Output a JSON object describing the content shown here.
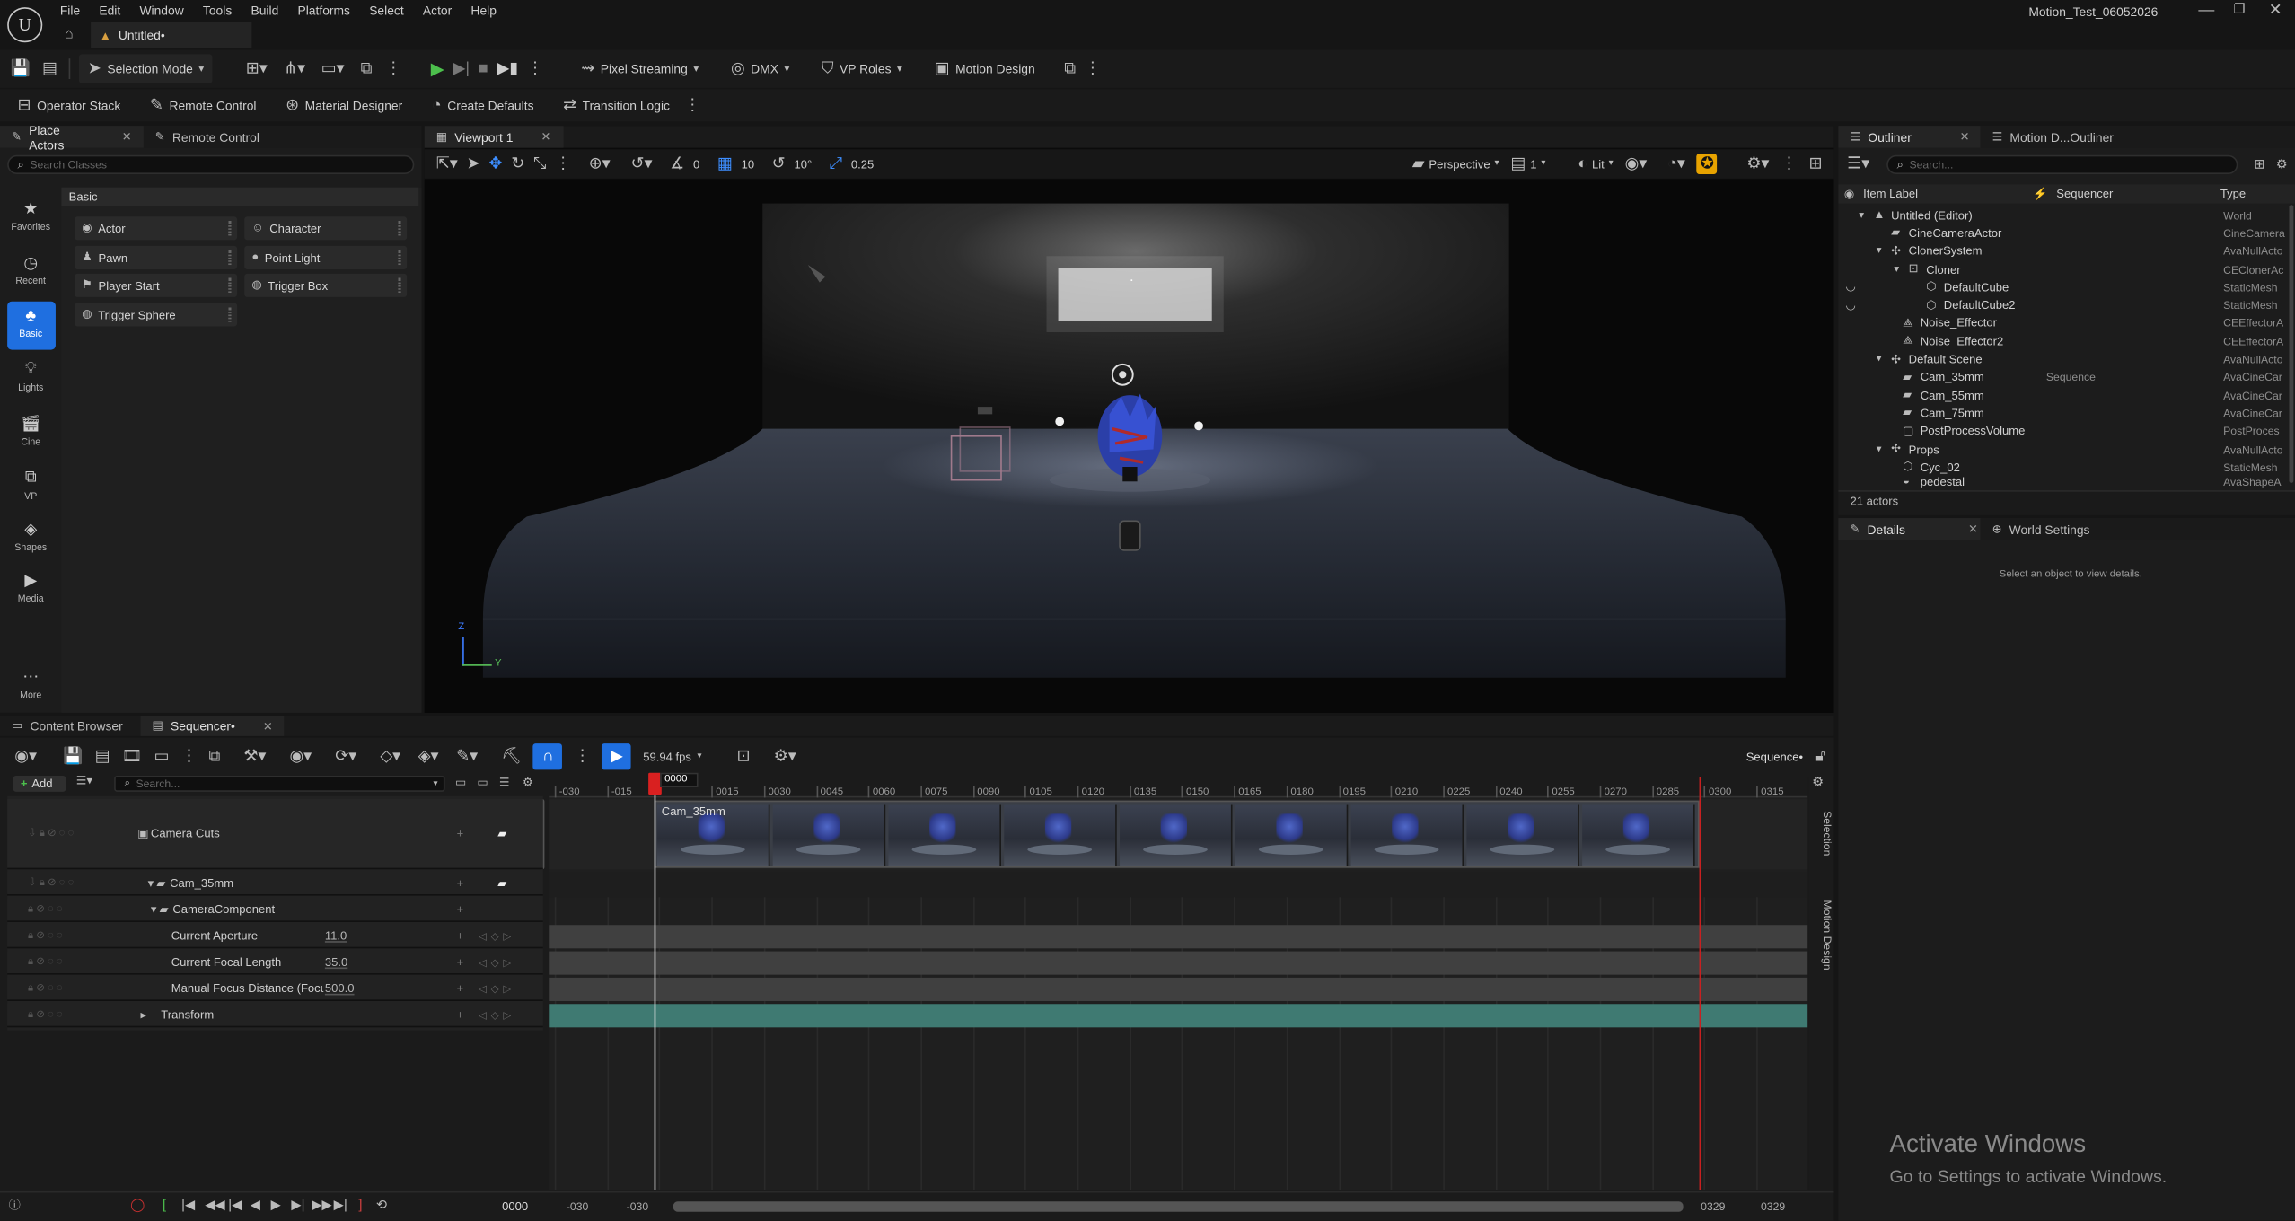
{
  "titlebar": {
    "menu": [
      "File",
      "Edit",
      "Window",
      "Tools",
      "Build",
      "Platforms",
      "Select",
      "Actor",
      "Help"
    ],
    "doc_tab": "Untitled•",
    "project_name": "Motion_Test_06052026",
    "window_controls": [
      "minimize-icon",
      "restore-icon",
      "close-icon"
    ]
  },
  "main_toolbar": {
    "selection_mode": "Selection Mode",
    "pixel_streaming": "Pixel Streaming",
    "dmx": "DMX",
    "vp_roles": "VP Roles",
    "motion_design": "Motion Design"
  },
  "secondary_toolbar": {
    "items": [
      "Operator Stack",
      "Remote Control",
      "Material Designer",
      "Create Defaults",
      "Transition Logic"
    ]
  },
  "left_panel": {
    "tabs": [
      "Place Actors",
      "Remote Control"
    ],
    "search_placeholder": "Search Classes",
    "section": "Basic",
    "categories": [
      "Favorites",
      "Recent",
      "Basic",
      "Lights",
      "Cine",
      "VP",
      "Shapes",
      "Media",
      "More"
    ],
    "selected_category": "Basic",
    "actors": [
      "Actor",
      "Character",
      "Pawn",
      "Point Light",
      "Player Start",
      "Trigger Box",
      "Trigger Sphere"
    ]
  },
  "viewport": {
    "tab": "Viewport 1",
    "snap_angle": "0",
    "grid_snap": "10",
    "rot_snap": "10°",
    "scale_snap": "0.25",
    "view_mode": "Perspective",
    "view_index": "1",
    "lighting": "Lit",
    "axis_labels": [
      "Z",
      "Y"
    ]
  },
  "outliner": {
    "tabs": [
      "Outliner",
      "Motion D...Outliner"
    ],
    "search_placeholder": "Search...",
    "columns": [
      "Item Label",
      "Sequencer",
      "Type"
    ],
    "rows": [
      {
        "label": "Untitled (Editor)",
        "type": "World",
        "sequencer": ""
      },
      {
        "label": "CineCameraActor",
        "type": "CineCamera",
        "sequencer": ""
      },
      {
        "label": "ClonerSystem",
        "type": "AvaNullActo",
        "sequencer": ""
      },
      {
        "label": "Cloner",
        "type": "CEClonerAc",
        "sequencer": ""
      },
      {
        "label": "DefaultCube",
        "type": "StaticMesh",
        "sequencer": ""
      },
      {
        "label": "DefaultCube2",
        "type": "StaticMesh",
        "sequencer": ""
      },
      {
        "label": "Noise_Effector",
        "type": "CEEffectorA",
        "sequencer": ""
      },
      {
        "label": "Noise_Effector2",
        "type": "CEEffectorA",
        "sequencer": ""
      },
      {
        "label": "Default Scene",
        "type": "AvaNullActo",
        "sequencer": ""
      },
      {
        "label": "Cam_35mm",
        "type": "AvaCineCar",
        "sequencer": "Sequence"
      },
      {
        "label": "Cam_55mm",
        "type": "AvaCineCar",
        "sequencer": ""
      },
      {
        "label": "Cam_75mm",
        "type": "AvaCineCar",
        "sequencer": ""
      },
      {
        "label": "PostProcessVolume",
        "type": "PostProces",
        "sequencer": ""
      },
      {
        "label": "Props",
        "type": "AvaNullActo",
        "sequencer": ""
      },
      {
        "label": "Cyc_02",
        "type": "StaticMesh",
        "sequencer": ""
      },
      {
        "label": "pedestal",
        "type": "AvaShapeA",
        "sequencer": ""
      }
    ],
    "actor_count": "21 actors"
  },
  "details": {
    "tabs": [
      "Details",
      "World Settings"
    ],
    "empty_text": "Select an object to view details."
  },
  "bottom_tabs": [
    "Content Browser",
    "Sequencer•"
  ],
  "sequencer": {
    "fps": "59.94 fps",
    "name": "Sequence•",
    "add_label": "Add",
    "search_placeholder": "Search...",
    "tracks": [
      {
        "label": "Camera Cuts",
        "value": ""
      },
      {
        "label": "Cam_35mm",
        "value": ""
      },
      {
        "label": "CameraComponent",
        "value": ""
      },
      {
        "label": "Current Aperture",
        "value": "11.0"
      },
      {
        "label": "Current Focal Length",
        "value": "35.0"
      },
      {
        "label": "Manual Focus Distance (Focu",
        "value": "500.0"
      },
      {
        "label": "Transform",
        "value": ""
      }
    ],
    "ticks": [
      "-030",
      "-015",
      "0015",
      "0030",
      "0045",
      "0060",
      "0075",
      "0090",
      "0105",
      "0120",
      "0135",
      "0150",
      "0165",
      "0180",
      "0195",
      "0210",
      "0225",
      "0240",
      "0255",
      "0270",
      "0285",
      "0300",
      "0315"
    ],
    "playhead": "0000",
    "clip_label": "Cam_35mm",
    "current_frame": "0000",
    "range_start_a": "-030",
    "range_start_b": "-030",
    "range_end_a": "0329",
    "range_end_b": "0329",
    "side_tabs": [
      "Selection",
      "Motion Design"
    ]
  },
  "watermark": {
    "title": "Activate Windows",
    "subtitle": "Go to Settings to activate Windows."
  }
}
